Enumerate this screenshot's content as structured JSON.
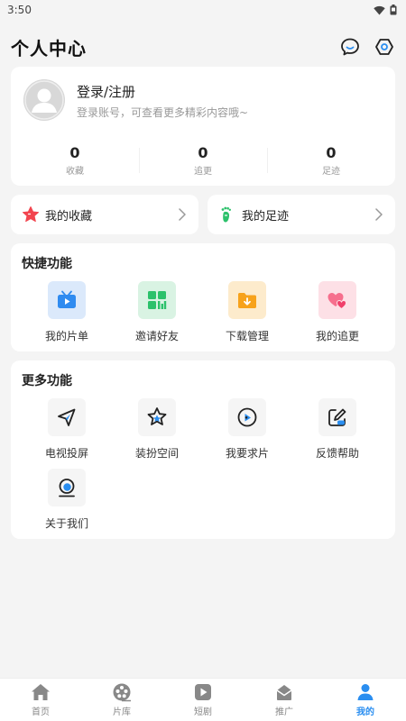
{
  "status_bar": {
    "time": "3:50"
  },
  "header": {
    "title": "个人中心"
  },
  "profile": {
    "login_title": "登录/注册",
    "login_subtitle": "登录账号，可查看更多精彩内容哦~",
    "stats": [
      {
        "value": "0",
        "label": "收藏"
      },
      {
        "value": "0",
        "label": "追更"
      },
      {
        "value": "0",
        "label": "足迹"
      }
    ]
  },
  "quick_links": [
    {
      "label": "我的收藏",
      "icon": "star-icon"
    },
    {
      "label": "我的足迹",
      "icon": "footprint-icon"
    }
  ],
  "shortcuts": {
    "title": "快捷功能",
    "items": [
      {
        "label": "我的片单",
        "icon": "tv-list-icon",
        "bg": "#dbe9fb"
      },
      {
        "label": "邀请好友",
        "icon": "qr-code-icon",
        "bg": "#d9f3e3"
      },
      {
        "label": "下载管理",
        "icon": "download-folder-icon",
        "bg": "#fdebcc"
      },
      {
        "label": "我的追更",
        "icon": "hearts-icon",
        "bg": "#fde0e6"
      }
    ]
  },
  "more": {
    "title": "更多功能",
    "items": [
      {
        "label": "电视投屏",
        "icon": "cast-icon"
      },
      {
        "label": "装扮空间",
        "icon": "star-outline-icon"
      },
      {
        "label": "我要求片",
        "icon": "disc-icon"
      },
      {
        "label": "反馈帮助",
        "icon": "feedback-edit-icon"
      },
      {
        "label": "关于我们",
        "icon": "about-icon"
      }
    ]
  },
  "bottom_nav": [
    {
      "label": "首页",
      "icon": "home-icon"
    },
    {
      "label": "片库",
      "icon": "film-reel-icon"
    },
    {
      "label": "短剧",
      "icon": "play-icon"
    },
    {
      "label": "推广",
      "icon": "mail-icon"
    },
    {
      "label": "我的",
      "icon": "user-icon",
      "active": true
    }
  ],
  "colors": {
    "accent": "#2a8ef0",
    "icon_dark": "#222222"
  }
}
